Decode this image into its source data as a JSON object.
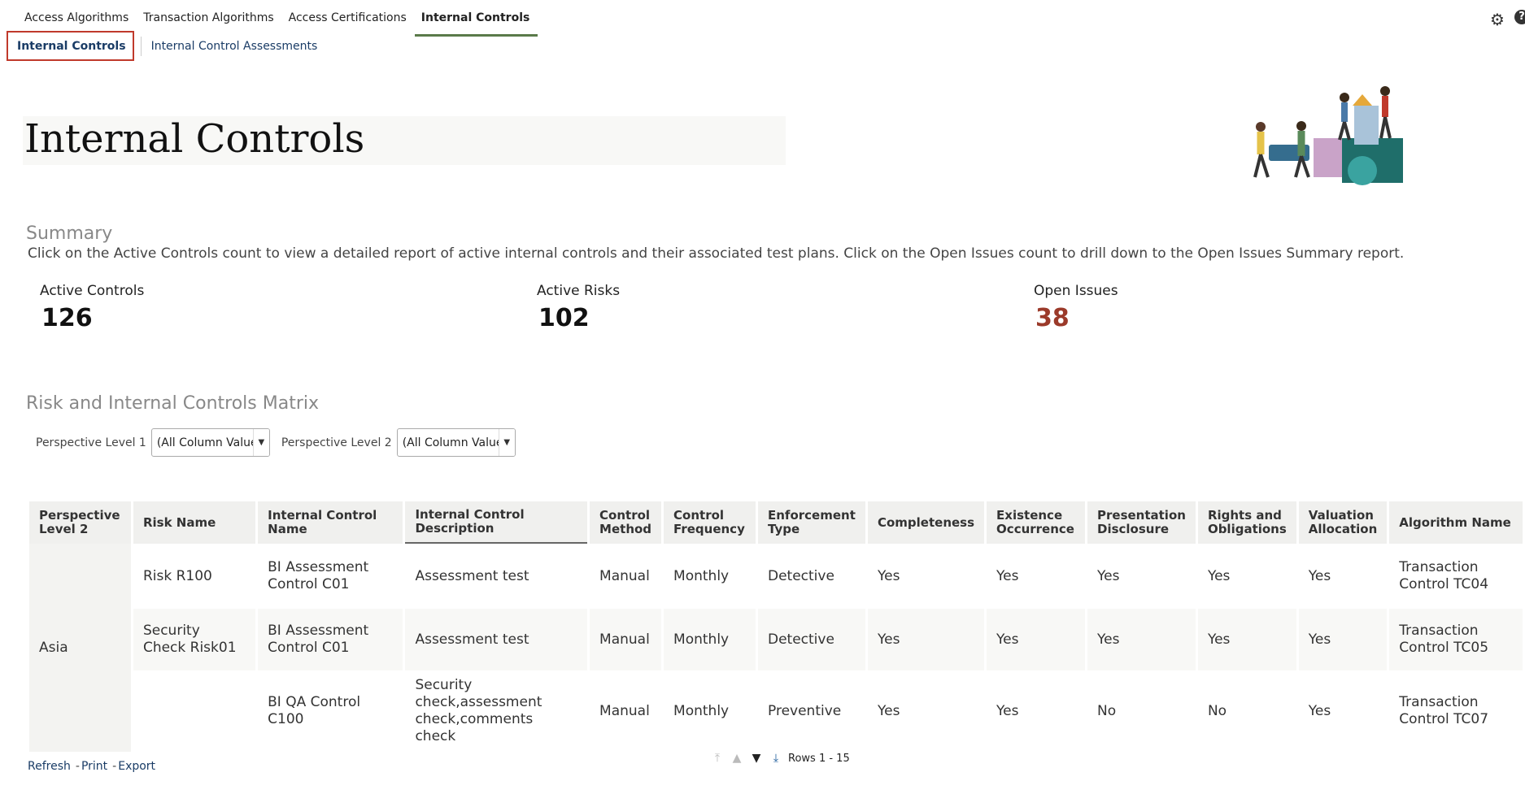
{
  "top_tabs": [
    {
      "label": "Access Algorithms"
    },
    {
      "label": "Transaction Algorithms"
    },
    {
      "label": "Access Certifications"
    },
    {
      "label": "Internal Controls"
    }
  ],
  "sub_tabs": {
    "active": "Internal Controls",
    "other": "Internal Control Assessments"
  },
  "page_title": "Internal Controls",
  "summary": {
    "heading": "Summary",
    "description": "Click on the Active Controls count to view a detailed report of active internal controls and their associated test plans. Click on the Open Issues count to drill down to the Open Issues Summary report.",
    "metrics": [
      {
        "label": "Active Controls",
        "value": "126"
      },
      {
        "label": "Active Risks",
        "value": "102"
      },
      {
        "label": "Open Issues",
        "value": "38"
      }
    ]
  },
  "matrix": {
    "heading": "Risk and Internal Controls Matrix",
    "filter1_label": "Perspective Level 1",
    "filter1_value": "(All Column Values)",
    "filter2_label": "Perspective Level 2",
    "filter2_value": "(All Column Values)",
    "columns": [
      "Perspective Level 2",
      "Risk Name",
      "Internal Control Name",
      "Internal Control Description",
      "Control Method",
      "Control Frequency",
      "Enforcement Type",
      "Completeness",
      "Existence Occurrence",
      "Presentation Disclosure",
      "Rights and Obligations",
      "Valuation Allocation",
      "Algorithm Name"
    ],
    "group": "Asia",
    "rows": [
      [
        "Risk R100",
        "BI Assessment Control C01",
        "Assessment test",
        "Manual",
        "Monthly",
        "Detective",
        "Yes",
        "Yes",
        "Yes",
        "Yes",
        "Yes",
        "Transaction Control TC04"
      ],
      [
        "Security Check Risk01",
        "BI Assessment Control C01",
        "Assessment test",
        "Manual",
        "Monthly",
        "Detective",
        "Yes",
        "Yes",
        "Yes",
        "Yes",
        "Yes",
        "Transaction Control TC05"
      ],
      [
        "",
        "BI QA Control C100",
        "Security check,assessment check,comments check",
        "Manual",
        "Monthly",
        "Preventive",
        "Yes",
        "Yes",
        "No",
        "No",
        "Yes",
        "Transaction Control TC07"
      ]
    ]
  },
  "footer": {
    "refresh": "Refresh",
    "print": "Print",
    "export": "Export",
    "rows": "Rows 1 - 15"
  },
  "colors": {
    "accent_tab": "#5a7a4a",
    "open_issues": "#9b3a2a",
    "link": "#1a3c66",
    "highlight_border": "#c0392b"
  }
}
